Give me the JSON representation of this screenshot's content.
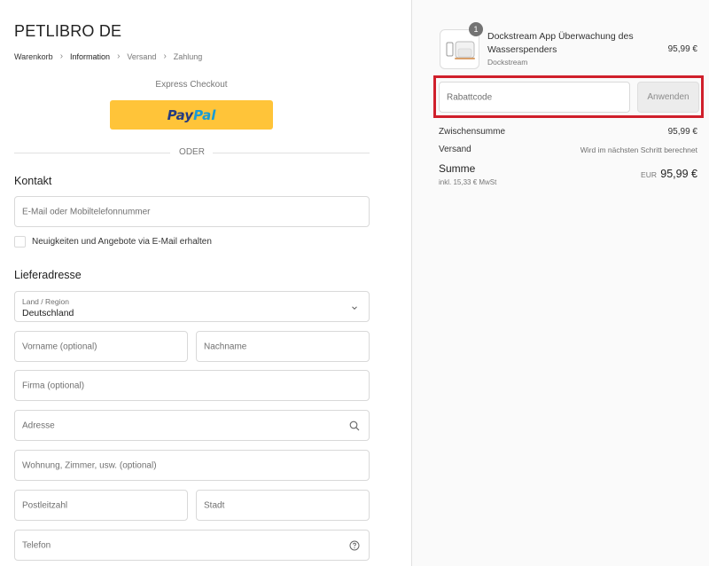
{
  "store": {
    "title": "PETLIBRO DE"
  },
  "breadcrumb": [
    {
      "label": "Warenkorb"
    },
    {
      "label": "Information"
    },
    {
      "label": "Versand"
    },
    {
      "label": "Zahlung"
    }
  ],
  "express_checkout": {
    "label": "Express Checkout",
    "paypal_part1": "Pay",
    "paypal_part2": "Pal"
  },
  "divider": {
    "label": "ODER"
  },
  "contact": {
    "title": "Kontakt",
    "email_placeholder": "E-Mail oder Mobiltelefonnummer",
    "newsletter_label": "Neuigkeiten und Angebote via E-Mail erhalten"
  },
  "shipping": {
    "title": "Lieferadresse",
    "country_label": "Land / Region",
    "country_value": "Deutschland",
    "first_name_placeholder": "Vorname (optional)",
    "last_name_placeholder": "Nachname",
    "company_placeholder": "Firma (optional)",
    "address_placeholder": "Adresse",
    "apartment_placeholder": "Wohnung, Zimmer, usw. (optional)",
    "postal_placeholder": "Postleitzahl",
    "city_placeholder": "Stadt",
    "phone_placeholder": "Telefon"
  },
  "order": {
    "item": {
      "quantity": "1",
      "name": "Dockstream App Überwachung des Wasserspenders",
      "variant": "Dockstream",
      "price": "95,99 €"
    },
    "discount": {
      "placeholder": "Rabattcode",
      "apply_label": "Anwenden"
    },
    "subtotal": {
      "label": "Zwischensumme",
      "value": "95,99 €"
    },
    "shipping": {
      "label": "Versand",
      "value": "Wird im nächsten Schritt berechnet"
    },
    "total": {
      "label": "Summe",
      "tax_note": "inkl. 15,33 € MwSt",
      "currency": "EUR",
      "value": "95,99 €"
    }
  },
  "colors": {
    "paypal_yellow": "#ffc439",
    "highlight_red": "#d01f2b"
  }
}
